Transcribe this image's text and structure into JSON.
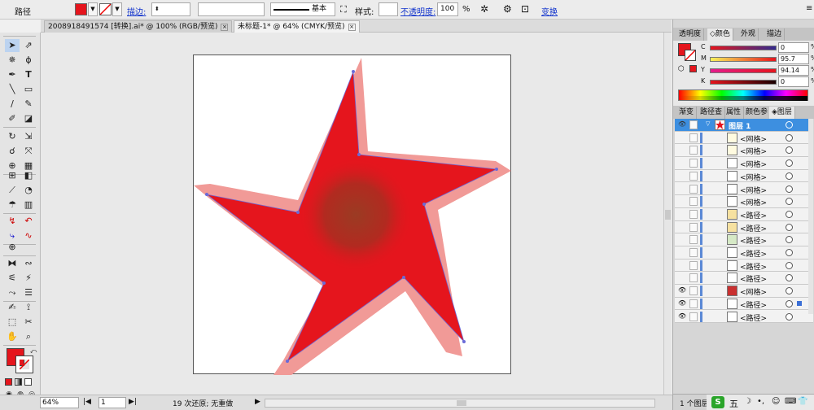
{
  "control_bar": {
    "object_type": "路径",
    "stroke_label": "描边:",
    "stroke_line_label": "基本",
    "style_label": "样式:",
    "opacity_label": "不透明度:",
    "opacity_value": "100",
    "opacity_unit": "%",
    "transform_link": "变换",
    "fill_color": "#e5151d"
  },
  "doc_tabs": [
    {
      "label": "2008918491574 [转换].ai* @ 100% (RGB/预览)",
      "active": false
    },
    {
      "label": "未标题-1* @ 64% (CMYK/预览)",
      "active": true
    }
  ],
  "status_bar": {
    "zoom": "64%",
    "page": "1",
    "message": "19 次还原; 无重做"
  },
  "color_panel": {
    "tabs": [
      "透明度",
      "颜色",
      "外观",
      "描边"
    ],
    "active_tab": "颜色",
    "sliders": [
      {
        "label": "C",
        "value": "0"
      },
      {
        "label": "M",
        "value": "95.7"
      },
      {
        "label": "Y",
        "value": "94.14"
      },
      {
        "label": "K",
        "value": "0"
      }
    ],
    "unit": "%",
    "fill": "#e5151d"
  },
  "layers_panel": {
    "tabs": [
      "渐变",
      "路径查",
      "属性",
      "颜色参",
      "图层"
    ],
    "active_tab": "图层",
    "layer_name": "图层 1",
    "items": [
      "<网格>",
      "<网格>",
      "<网格>",
      "<网格>",
      "<网格>",
      "<网格>",
      "<路径>",
      "<路径>",
      "<路径>",
      "<路径>",
      "<路径>",
      "<路径>",
      "<网格>",
      "<路径>",
      "<路径>"
    ],
    "footer": "1 个图层"
  },
  "artwork": {
    "star_color": "#e5151d",
    "halo_color": "#f19a97",
    "center_color": "#9b3b23"
  },
  "taskbar": {
    "ime_label": "五"
  }
}
